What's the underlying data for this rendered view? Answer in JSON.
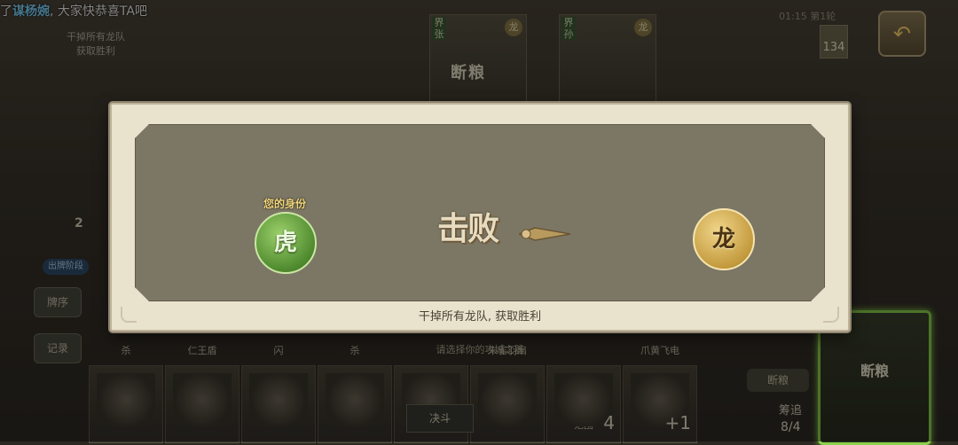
{
  "banner": {
    "prefix": "了",
    "name": "谋杨婉",
    "suffix": ", 大家快恭喜TA吧"
  },
  "board": {
    "goal_line1": "干掉所有龙队",
    "goal_line2": "获取胜利",
    "round_info": "01:15 第1轮",
    "deck_count": "134",
    "phase_title": "断粮",
    "portraits": [
      {
        "tag": "界张",
        "badge": "龙"
      },
      {
        "tag": "界孙",
        "badge": "龙"
      }
    ],
    "side_buttons": {
      "order": "牌序",
      "record": "记录"
    },
    "side_pill": "出牌阶段",
    "side_count": "2",
    "hand_cards": [
      {
        "label": "杀",
        "num": ""
      },
      {
        "label": "仁王盾",
        "num": ""
      },
      {
        "label": "闪",
        "num": ""
      },
      {
        "label": "杀",
        "num": ""
      },
      {
        "label": "请选择你的攻城之器",
        "num": ""
      },
      {
        "label": "朱雀羽扇",
        "num": ""
      },
      {
        "label": "范围",
        "num": "4"
      },
      {
        "label": "爪黄飞电",
        "num": "+1"
      }
    ],
    "duel_button": "决斗",
    "right_button": "断粮",
    "counter_label": "筹追",
    "counter_value": "8/4",
    "green_card_title": "断粮"
  },
  "modal": {
    "identity_label": "您的身份",
    "player_identity": "虎",
    "result_word": "击败",
    "target_identity": "龙",
    "footer": "干掉所有龙队, 获取胜利"
  },
  "colors": {
    "tiger": "#4f8a2f",
    "dragon": "#c49b3e",
    "highlight": "#8bd14c",
    "name": "#7fd7ff"
  }
}
